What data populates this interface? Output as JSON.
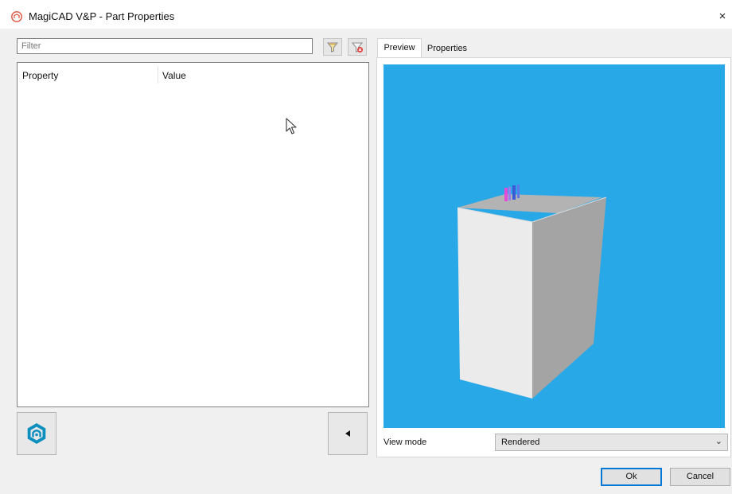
{
  "window": {
    "title": "MagiCAD V&P - Part Properties",
    "close_symbol": "×",
    "app_icon": "magicad-app-icon"
  },
  "filter": {
    "placeholder": "Filter",
    "value": "",
    "filter_icon": "funnel-icon",
    "clear_icon": "funnel-clear-icon"
  },
  "property_list": {
    "columns": [
      "Property",
      "Value"
    ],
    "rows": []
  },
  "left_buttons": {
    "logo_icon": "magicad-logo-icon",
    "collapse_icon": "triangle-left-icon",
    "collapse_symbol": "◀"
  },
  "tabs": [
    {
      "label": "Preview",
      "active": true
    },
    {
      "label": "Properties",
      "active": false
    }
  ],
  "preview": {
    "background_color": "#29a8e8",
    "object": "3d-box-with-connectors"
  },
  "view_mode": {
    "label": "View mode",
    "value": "Rendered",
    "chevron": "⌄"
  },
  "buttons": {
    "ok": "Ok",
    "cancel": "Cancel"
  }
}
